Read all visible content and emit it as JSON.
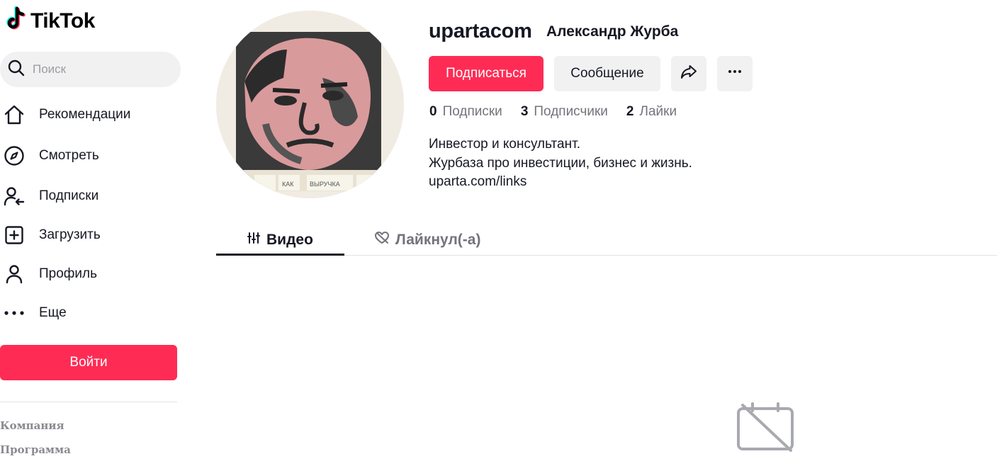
{
  "brand": {
    "name": "TikTok",
    "accent": "#fe2c55",
    "logo_icon": "tiktok-note-icon"
  },
  "search": {
    "placeholder": "Поиск",
    "value": "",
    "icon": "search-icon"
  },
  "nav": [
    {
      "label": "Рекомендации",
      "icon": "home-icon"
    },
    {
      "label": "Смотреть",
      "icon": "compass-icon"
    },
    {
      "label": "Подписки",
      "icon": "following-user-icon"
    },
    {
      "label": "Загрузить",
      "icon": "upload-plus-icon"
    },
    {
      "label": "Профиль",
      "icon": "profile-user-icon"
    },
    {
      "label": "Еще",
      "icon": "more-dots-icon"
    }
  ],
  "login_label": "Войти",
  "footer": {
    "links": [
      "Компания",
      "Программа"
    ]
  },
  "profile": {
    "username": "upartacom",
    "fullname": "Александр Журба",
    "follow_label": "Подписаться",
    "message_label": "Сообщение",
    "share_icon": "share-arrow-icon",
    "more_icon": "more-dots-icon",
    "stats": [
      {
        "value": "0",
        "label": "Подписки"
      },
      {
        "value": "3",
        "label": "Подписчики"
      },
      {
        "value": "2",
        "label": "Лайки"
      }
    ],
    "bio": [
      "Инвестор и консультант.",
      "Журбаза про инвестиции, бизнес и жизнь.",
      "uparta.com/links"
    ],
    "avatar_captions": [
      "КАК",
      "ВЫРУЧКА"
    ]
  },
  "tabs": [
    {
      "label": "Видео",
      "icon": "grid-bars-icon",
      "active": true
    },
    {
      "label": "Лайкнул(-а)",
      "icon": "hidden-heart-icon",
      "active": false
    }
  ],
  "empty_state": {
    "icon": "no-content-icon"
  }
}
